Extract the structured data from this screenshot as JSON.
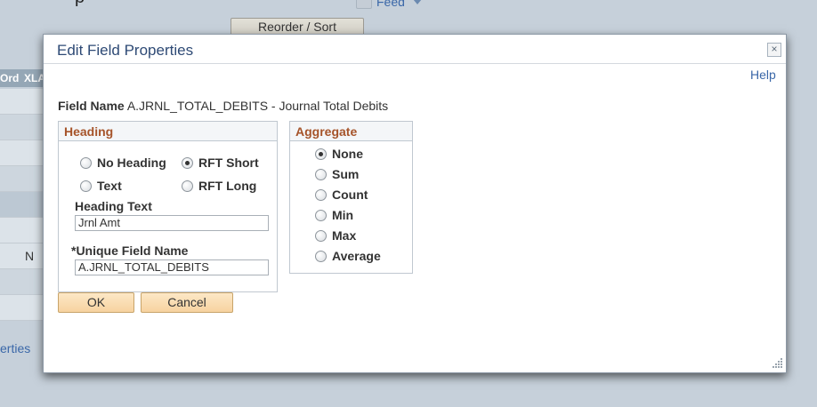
{
  "background": {
    "feed_label": "Feed",
    "reorder_sort_label": "Reorder / Sort",
    "table_headers": [
      "Ord",
      "XLA"
    ],
    "table_cell_value": "N",
    "properties_link": "erties"
  },
  "modal": {
    "title": "Edit Field Properties",
    "close_symbol": "×",
    "help_label": "Help",
    "field_name": {
      "label": "Field Name",
      "value": "A.JRNL_TOTAL_DEBITS - Journal Total Debits"
    },
    "heading_group": {
      "title": "Heading",
      "options": [
        {
          "label": "No Heading",
          "checked": false
        },
        {
          "label": "RFT Short",
          "checked": true
        },
        {
          "label": "Text",
          "checked": false
        },
        {
          "label": "RFT Long",
          "checked": false
        }
      ],
      "heading_text_label": "Heading Text",
      "heading_text_value": "Jrnl Amt",
      "unique_field_label": "*Unique Field Name",
      "unique_field_value": "A.JRNL_TOTAL_DEBITS"
    },
    "aggregate_group": {
      "title": "Aggregate",
      "options": [
        {
          "label": "None",
          "checked": true
        },
        {
          "label": "Sum",
          "checked": false
        },
        {
          "label": "Count",
          "checked": false
        },
        {
          "label": "Min",
          "checked": false
        },
        {
          "label": "Max",
          "checked": false
        },
        {
          "label": "Average",
          "checked": false
        }
      ]
    },
    "buttons": {
      "ok_label": "OK",
      "cancel_label": "Cancel"
    }
  }
}
